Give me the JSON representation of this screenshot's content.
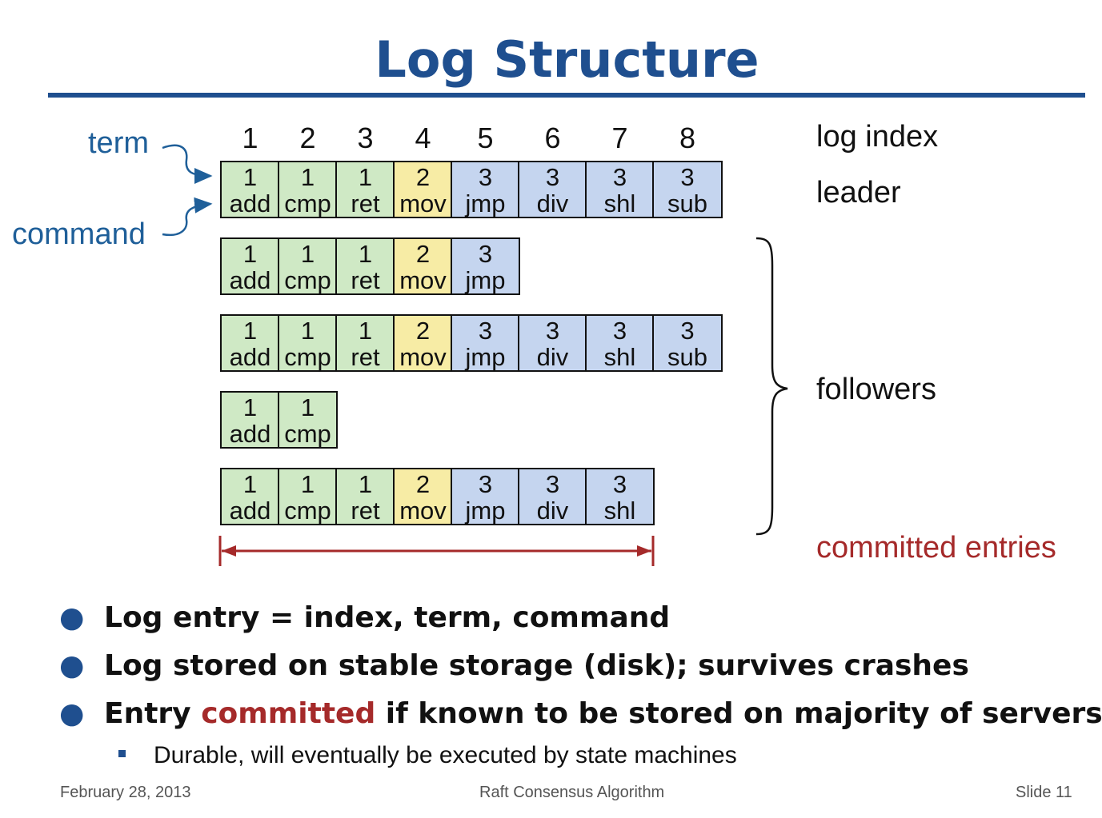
{
  "title": "Log Structure",
  "labels": {
    "term": "term",
    "command": "command",
    "log_index": "log index",
    "leader": "leader",
    "followers": "followers",
    "committed_entries": "committed entries"
  },
  "log_indices": [
    "1",
    "2",
    "3",
    "4",
    "5",
    "6",
    "7",
    "8"
  ],
  "term_colors": {
    "1": "#cfe9c5",
    "2": "#f7eca5",
    "3": "#c5d5ef"
  },
  "logs": [
    {
      "role": "leader",
      "entries": [
        {
          "term": "1",
          "cmd": "add"
        },
        {
          "term": "1",
          "cmd": "cmp"
        },
        {
          "term": "1",
          "cmd": "ret"
        },
        {
          "term": "2",
          "cmd": "mov"
        },
        {
          "term": "3",
          "cmd": "jmp"
        },
        {
          "term": "3",
          "cmd": "div"
        },
        {
          "term": "3",
          "cmd": "shl"
        },
        {
          "term": "3",
          "cmd": "sub"
        }
      ]
    },
    {
      "role": "follower",
      "entries": [
        {
          "term": "1",
          "cmd": "add"
        },
        {
          "term": "1",
          "cmd": "cmp"
        },
        {
          "term": "1",
          "cmd": "ret"
        },
        {
          "term": "2",
          "cmd": "mov"
        },
        {
          "term": "3",
          "cmd": "jmp"
        }
      ]
    },
    {
      "role": "follower",
      "entries": [
        {
          "term": "1",
          "cmd": "add"
        },
        {
          "term": "1",
          "cmd": "cmp"
        },
        {
          "term": "1",
          "cmd": "ret"
        },
        {
          "term": "2",
          "cmd": "mov"
        },
        {
          "term": "3",
          "cmd": "jmp"
        },
        {
          "term": "3",
          "cmd": "div"
        },
        {
          "term": "3",
          "cmd": "shl"
        },
        {
          "term": "3",
          "cmd": "sub"
        }
      ]
    },
    {
      "role": "follower",
      "entries": [
        {
          "term": "1",
          "cmd": "add"
        },
        {
          "term": "1",
          "cmd": "cmp"
        }
      ]
    },
    {
      "role": "follower",
      "entries": [
        {
          "term": "1",
          "cmd": "add"
        },
        {
          "term": "1",
          "cmd": "cmp"
        },
        {
          "term": "1",
          "cmd": "ret"
        },
        {
          "term": "2",
          "cmd": "mov"
        },
        {
          "term": "3",
          "cmd": "jmp"
        },
        {
          "term": "3",
          "cmd": "div"
        },
        {
          "term": "3",
          "cmd": "shl"
        }
      ]
    }
  ],
  "committed_through_index": 7,
  "bullets": [
    {
      "before": "Log entry = index, term, command",
      "highlight": "",
      "after": ""
    },
    {
      "before": "Log stored on stable storage (disk); survives crashes",
      "highlight": "",
      "after": ""
    },
    {
      "before": "Entry ",
      "highlight": "committed",
      "after": " if known to be stored on majority of servers"
    }
  ],
  "sub_bullet": "Durable, will eventually be executed by state machines",
  "footer": {
    "date": "February 28, 2013",
    "center": "Raft Consensus Algorithm",
    "slide": "Slide 11"
  },
  "colors": {
    "accent_blue": "#1f4f8f",
    "committed_red": "#a52a2a"
  }
}
